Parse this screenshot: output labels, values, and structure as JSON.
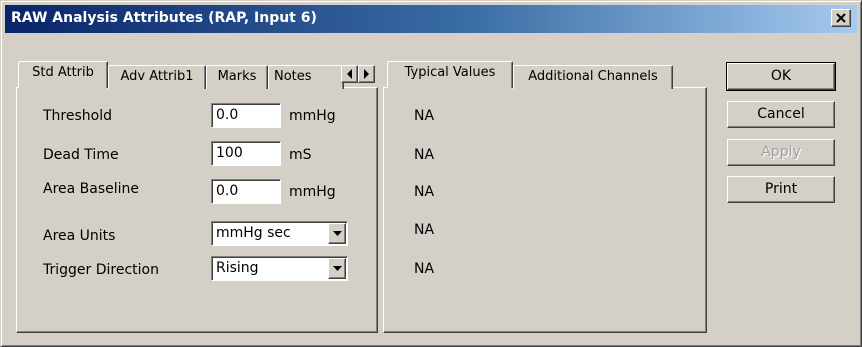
{
  "window": {
    "title": "RAW Analysis Attributes  (RAP, Input 6)"
  },
  "left_tabs": [
    {
      "label": "Std Attrib",
      "active": true
    },
    {
      "label": "Adv Attrib1",
      "active": false
    },
    {
      "label": "Marks",
      "active": false
    },
    {
      "label": "Notes",
      "active": false
    }
  ],
  "std_attrib": {
    "threshold": {
      "label": "Threshold",
      "value": "0.0",
      "unit": "mmHg"
    },
    "dead_time": {
      "label": "Dead Time",
      "value": "100",
      "unit": "mS"
    },
    "area_baseline": {
      "label": "Area Baseline",
      "value": "0.0",
      "unit": "mmHg"
    },
    "area_units": {
      "label": "Area Units",
      "selected": "mmHg sec"
    },
    "trigger_direction": {
      "label": "Trigger Direction",
      "selected": "Rising"
    }
  },
  "right_tabs": [
    {
      "label": "Typical Values",
      "active": true
    },
    {
      "label": "Additional Channels",
      "active": false
    }
  ],
  "typical_values": [
    "NA",
    "NA",
    "NA",
    "NA",
    "NA"
  ],
  "buttons": {
    "ok": "OK",
    "cancel": "Cancel",
    "apply": "Apply",
    "print": "Print"
  }
}
